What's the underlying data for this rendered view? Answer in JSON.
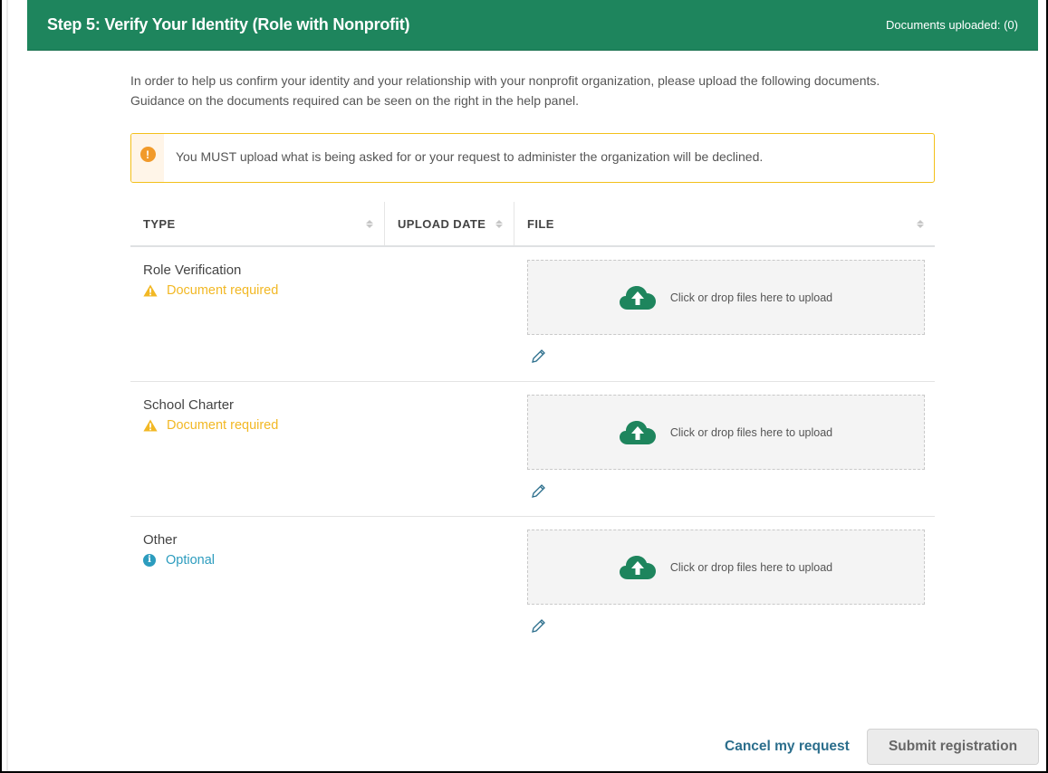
{
  "header": {
    "title": "Step 5: Verify Your Identity (Role with Nonprofit)",
    "documents_uploaded": "Documents uploaded: (0)"
  },
  "intro": "In order to help us confirm your identity and your relationship with your nonprofit organization, please upload the following documents. Guidance on the documents required can be seen on the right in the help panel.",
  "alert": {
    "icon": "exclamation-circle-icon",
    "message": "You MUST upload what is being asked for or your request to administer the organization will be declined.",
    "color": "#f3c01a"
  },
  "table": {
    "columns": [
      {
        "label": "TYPE",
        "sortable": true
      },
      {
        "label": "UPLOAD DATE",
        "sortable": true
      },
      {
        "label": "FILE",
        "sortable": true
      }
    ],
    "rows": [
      {
        "type": "Role Verification",
        "status": "Document required",
        "status_kind": "required",
        "upload_date": "",
        "dropzone_label": "Click or drop files here to upload"
      },
      {
        "type": "School Charter",
        "status": "Document required",
        "status_kind": "required",
        "upload_date": "",
        "dropzone_label": "Click or drop files here to upload"
      },
      {
        "type": "Other",
        "status": "Optional",
        "status_kind": "optional",
        "upload_date": "",
        "dropzone_label": "Click or drop files here to upload"
      }
    ]
  },
  "footer": {
    "cancel_label": "Cancel my request",
    "submit_label": "Submit registration",
    "submit_disabled": true
  },
  "colors": {
    "brand_green": "#1e855d",
    "required": "#f2b824",
    "optional": "#2c9cbe",
    "link": "#2b6e8c"
  }
}
